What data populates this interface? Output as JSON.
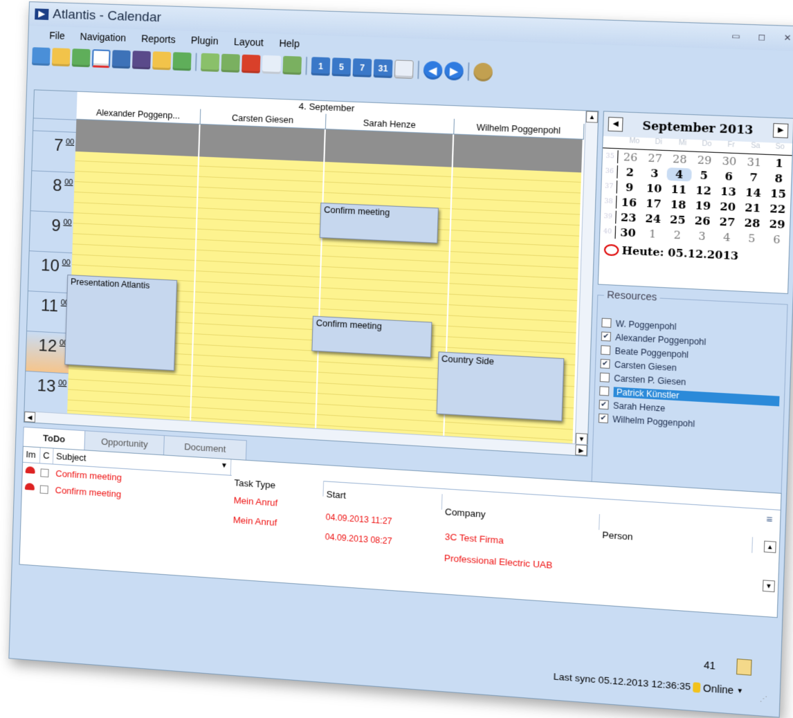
{
  "window": {
    "title": "Atlantis - Calendar",
    "min": "▭",
    "max": "◻",
    "close": "✕"
  },
  "menu": [
    "File",
    "Navigation",
    "Reports",
    "Plugin",
    "Layout",
    "Help"
  ],
  "toolbar": {
    "day1": "1",
    "day5": "5",
    "day7": "7",
    "day31": "31",
    "back": "◀",
    "forward": "▶"
  },
  "calendar": {
    "date_header": "4. September",
    "resources": [
      "Alexander Poggenp...",
      "Carsten Giesen",
      "Sarah Henze",
      "Wilhelm Poggenpohl"
    ],
    "times": [
      {
        "h": "7",
        "m": "00"
      },
      {
        "h": "8",
        "m": "00"
      },
      {
        "h": "9",
        "m": "00"
      },
      {
        "h": "10",
        "m": "00"
      },
      {
        "h": "11",
        "m": "00"
      },
      {
        "h": "12",
        "m": "00"
      },
      {
        "h": "13",
        "m": "00"
      }
    ],
    "appointments": [
      {
        "text": "Presentation Atlantis"
      },
      {
        "text": "Confirm meeting"
      },
      {
        "text": "Confirm meeting"
      },
      {
        "text": "Country Side"
      }
    ]
  },
  "minical": {
    "month": "September 2013",
    "weekdays": [
      "Mo",
      "Di",
      "Mi",
      "Do",
      "Fr",
      "Sa",
      "So"
    ],
    "weeks": [
      {
        "wk": "35",
        "days": [
          "26",
          "27",
          "28",
          "29",
          "30",
          "31",
          "1"
        ]
      },
      {
        "wk": "36",
        "days": [
          "2",
          "3",
          "4",
          "5",
          "6",
          "7",
          "8"
        ]
      },
      {
        "wk": "37",
        "days": [
          "9",
          "10",
          "11",
          "12",
          "13",
          "14",
          "15"
        ]
      },
      {
        "wk": "38",
        "days": [
          "16",
          "17",
          "18",
          "19",
          "20",
          "21",
          "22"
        ]
      },
      {
        "wk": "39",
        "days": [
          "23",
          "24",
          "25",
          "26",
          "27",
          "28",
          "29"
        ]
      },
      {
        "wk": "40",
        "days": [
          "30",
          "1",
          "2",
          "3",
          "4",
          "5",
          "6"
        ]
      }
    ],
    "today": "Heute: 05.12.2013",
    "prev": "◀",
    "next": "▶"
  },
  "resources_panel": {
    "title": "Resources",
    "items": [
      {
        "name": "W. Poggenpohl",
        "checked": ""
      },
      {
        "name": "Alexander Poggenpohl",
        "checked": "✔"
      },
      {
        "name": "Beate Poggenpohl",
        "checked": ""
      },
      {
        "name": "Carsten Giesen",
        "checked": "✔"
      },
      {
        "name": "Carsten P. Giesen",
        "checked": ""
      },
      {
        "name": "Patrick Künstler",
        "checked": ""
      },
      {
        "name": "Sarah Henze",
        "checked": "✔"
      },
      {
        "name": "Wilhelm Poggenpohl",
        "checked": "✔"
      }
    ],
    "remove": "✕"
  },
  "tabs": [
    "ToDo",
    "Opportunity",
    "Document"
  ],
  "todo": {
    "columns": [
      "Im",
      "C",
      "Subject",
      "Task Type",
      "Start",
      "Company",
      "Person"
    ],
    "rows": [
      {
        "subject": "Confirm meeting",
        "task_type": "Mein Anruf",
        "start": "04.09.2013 11:27",
        "company": "3C Test Firma"
      },
      {
        "subject": "Confirm meeting",
        "task_type": "Mein Anruf",
        "start": "04.09.2013 08:27",
        "company": "Professional Electric UAB"
      }
    ],
    "filter": "▼"
  },
  "status": {
    "count": "41",
    "sync": "Last sync 05.12.2013 12:36:35",
    "online": "Online"
  }
}
